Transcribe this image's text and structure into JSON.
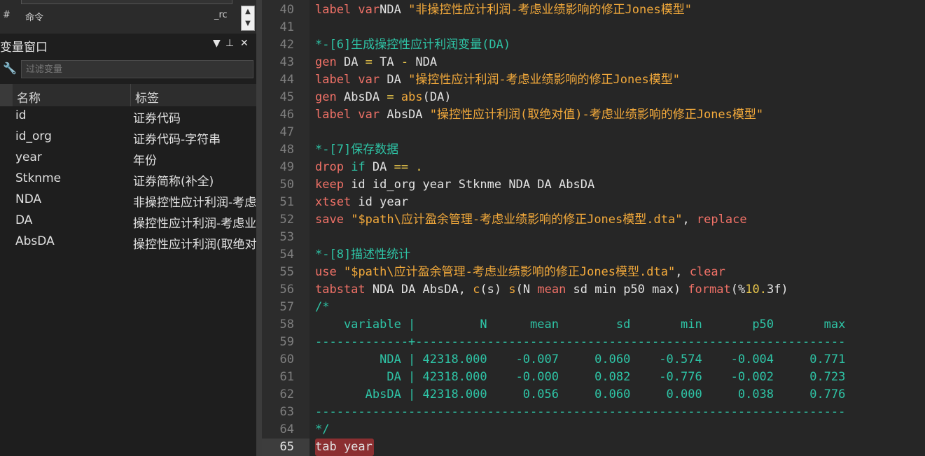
{
  "history": {
    "col_hash": "#",
    "col_command": "命令",
    "col_rc": "_rc"
  },
  "variables_window": {
    "title": "变量窗口",
    "filter_placeholder": "过滤变量",
    "col_name": "名称",
    "col_label": "标签",
    "rows": [
      {
        "name": "id",
        "label": "证券代码"
      },
      {
        "name": "id_org",
        "label": "证券代码-字符串"
      },
      {
        "name": "year",
        "label": "年份"
      },
      {
        "name": "Stknme",
        "label": "证券简称(补全)"
      },
      {
        "name": "NDA",
        "label": "非操控性应计利润-考虑业绩影响的修正Jones模型"
      },
      {
        "name": "DA",
        "label": "操控性应计利润-考虑业绩影响的修正Jones模型"
      },
      {
        "name": "AbsDA",
        "label": "操控性应计利润(取绝对值)-考虑业绩影响的修正Jones模型"
      }
    ]
  },
  "editor": {
    "active_line": 65,
    "lines": [
      {
        "n": 40,
        "tokens": [
          [
            "kw",
            "label var"
          ],
          [
            "",
            "NDA "
          ],
          [
            "str",
            "\"非操控性应计利润-考虑业绩影响的修正Jones模型\""
          ]
        ]
      },
      {
        "n": 41,
        "tokens": []
      },
      {
        "n": 42,
        "tokens": [
          [
            "cmt",
            "*-[6]生成操控性应计利润变量(DA)"
          ]
        ]
      },
      {
        "n": 43,
        "tokens": [
          [
            "kw",
            "gen"
          ],
          [
            "",
            " DA "
          ],
          [
            "op",
            "="
          ],
          [
            "",
            " TA "
          ],
          [
            "op",
            "-"
          ],
          [
            "",
            " NDA"
          ]
        ]
      },
      {
        "n": 44,
        "tokens": [
          [
            "kw",
            "label var"
          ],
          [
            "",
            " DA "
          ],
          [
            "str",
            "\"操控性应计利润-考虑业绩影响的修正Jones模型\""
          ]
        ]
      },
      {
        "n": 45,
        "tokens": [
          [
            "kw",
            "gen"
          ],
          [
            "",
            " AbsDA "
          ],
          [
            "op",
            "="
          ],
          [
            "",
            " "
          ],
          [
            "fn",
            "abs"
          ],
          [
            "",
            "(DA)"
          ]
        ]
      },
      {
        "n": 46,
        "tokens": [
          [
            "kw",
            "label var"
          ],
          [
            "",
            " AbsDA "
          ],
          [
            "str",
            "\"操控性应计利润(取绝对值)-考虑业绩影响的修正Jones模型\""
          ]
        ]
      },
      {
        "n": 47,
        "tokens": []
      },
      {
        "n": 48,
        "tokens": [
          [
            "cmt",
            "*-[7]保存数据"
          ]
        ]
      },
      {
        "n": 49,
        "tokens": [
          [
            "kw",
            "drop"
          ],
          [
            "",
            " "
          ],
          [
            "cmt",
            "if"
          ],
          [
            "",
            " DA "
          ],
          [
            "op",
            "=="
          ],
          [
            "",
            " "
          ],
          [
            "op",
            "."
          ]
        ]
      },
      {
        "n": 50,
        "tokens": [
          [
            "kw",
            "keep"
          ],
          [
            "",
            " id id_org year Stknme NDA DA AbsDA"
          ]
        ]
      },
      {
        "n": 51,
        "tokens": [
          [
            "kw",
            "xtset"
          ],
          [
            "",
            " id year"
          ]
        ]
      },
      {
        "n": 52,
        "tokens": [
          [
            "kw",
            "save"
          ],
          [
            "",
            " "
          ],
          [
            "str",
            "\"$path\\应计盈余管理-考虑业绩影响的修正Jones模型.dta\""
          ],
          [
            "",
            ", "
          ],
          [
            "kw",
            "replace"
          ]
        ]
      },
      {
        "n": 53,
        "tokens": []
      },
      {
        "n": 54,
        "tokens": [
          [
            "cmt",
            "*-[8]描述性统计"
          ]
        ]
      },
      {
        "n": 55,
        "tokens": [
          [
            "kw",
            "use"
          ],
          [
            "",
            " "
          ],
          [
            "str",
            "\"$path\\应计盈余管理-考虑业绩影响的修正Jones模型.dta\""
          ],
          [
            "",
            ", "
          ],
          [
            "kw",
            "clear"
          ]
        ]
      },
      {
        "n": 56,
        "tokens": [
          [
            "kw",
            "tabstat"
          ],
          [
            "",
            " NDA DA AbsDA, "
          ],
          [
            "fn",
            "c"
          ],
          [
            "",
            "(s) "
          ],
          [
            "fn",
            "s"
          ],
          [
            "",
            "(N "
          ],
          [
            "kw",
            "mean"
          ],
          [
            "",
            " sd min p50 max) "
          ],
          [
            "kw",
            "format"
          ],
          [
            "",
            "(%"
          ],
          [
            "num",
            "10"
          ],
          [
            "op",
            "."
          ],
          [
            "",
            "3f)"
          ]
        ]
      },
      {
        "n": 57,
        "tokens": [
          [
            "cmt",
            "/*"
          ]
        ]
      },
      {
        "n": 58,
        "tokens": [
          [
            "cmt",
            "    variable |         N      mean        sd       min       p50       max"
          ]
        ]
      },
      {
        "n": 59,
        "tokens": [
          [
            "cmt",
            "-------------+------------------------------------------------------------"
          ]
        ]
      },
      {
        "n": 60,
        "tokens": [
          [
            "cmt",
            "         NDA | 42318.000    -0.007     0.060    -0.574    -0.004     0.771"
          ]
        ]
      },
      {
        "n": 61,
        "tokens": [
          [
            "cmt",
            "          DA | 42318.000    -0.000     0.082    -0.776    -0.002     0.723"
          ]
        ]
      },
      {
        "n": 62,
        "tokens": [
          [
            "cmt",
            "       AbsDA | 42318.000     0.056     0.060     0.000     0.038     0.776"
          ]
        ]
      },
      {
        "n": 63,
        "tokens": [
          [
            "cmt",
            "--------------------------------------------------------------------------"
          ]
        ]
      },
      {
        "n": 64,
        "tokens": [
          [
            "cmt",
            "*/"
          ]
        ]
      },
      {
        "n": 65,
        "tokens": [
          [
            "",
            "tab year"
          ]
        ]
      }
    ]
  }
}
